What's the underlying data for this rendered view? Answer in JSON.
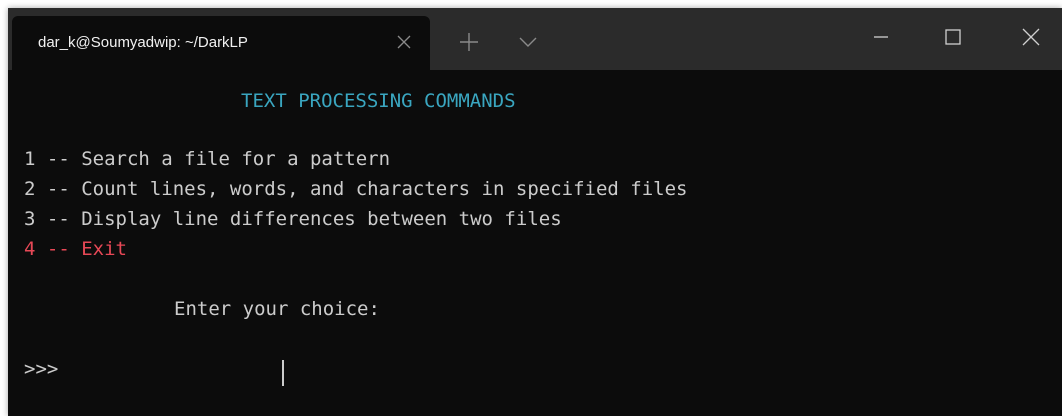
{
  "window": {
    "tab_title": "dar_k@Soumyadwip: ~/DarkLP",
    "tab_close_icon": "close-icon",
    "new_tab_icon": "plus-icon",
    "dropdown_icon": "chevron-down-icon",
    "minimize_icon": "minimize-icon",
    "maximize_icon": "maximize-icon",
    "close_window_icon": "close-icon"
  },
  "terminal": {
    "heading": "TEXT PROCESSING COMMANDS",
    "options": [
      "1 -- Search a file for a pattern",
      "2 -- Count lines, words, and characters in specified files",
      "3 -- Display line differences between two files",
      "4 -- Exit"
    ],
    "prompt": "Enter your choice:",
    "input_marker": ">>>",
    "input_value": ""
  },
  "colors": {
    "background": "#0c0c0c",
    "titlebar": "#2b2b2b",
    "text": "#cccccc",
    "heading": "#3aa6c0",
    "exit_option": "#e74856"
  }
}
